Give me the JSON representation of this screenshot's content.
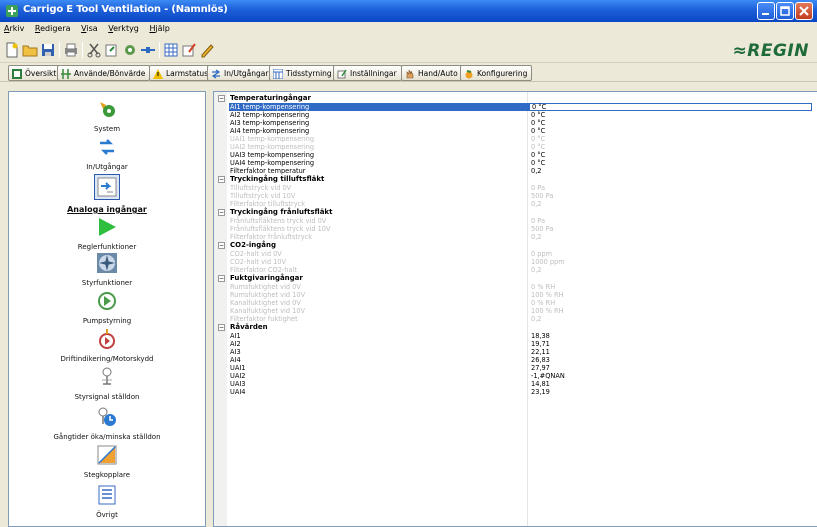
{
  "window": {
    "title": "Carrigo E Tool Ventilation - (Namnlös)"
  },
  "menu": [
    "Arkiv",
    "Redigera",
    "Visa",
    "Verktyg",
    "Hjälp"
  ],
  "brand": {
    "logo_text": "≈REGIN",
    "color": "#1f6b3a"
  },
  "toolbar2": [
    {
      "label": "Översikt",
      "icon": "overview-icon"
    },
    {
      "label": "Använde/Bönvärde",
      "icon": "setpoint-icon"
    },
    {
      "label": "Larmstatus",
      "icon": "alarm-icon"
    },
    {
      "label": "In/Utgångar",
      "icon": "io-icon"
    },
    {
      "label": "Tidsstyrning",
      "icon": "schedule-icon"
    },
    {
      "label": "Inställningar",
      "icon": "settings-icon"
    },
    {
      "label": "Hand/Auto",
      "icon": "hand-auto-icon"
    },
    {
      "label": "Konfigurering",
      "icon": "configure-icon"
    }
  ],
  "nav": [
    {
      "label": "System",
      "icon": "system-icon",
      "active": false
    },
    {
      "label": "In/Utgångar",
      "icon": "inout-icon",
      "active": false
    },
    {
      "label": "Analoga ingångar",
      "icon": "analog-inputs-icon",
      "active": true
    },
    {
      "label": "Reglerfunktioner",
      "icon": "control-functions-icon",
      "active": false
    },
    {
      "label": "Styrfunktioner",
      "icon": "fan-icon",
      "active": false
    },
    {
      "label": "Pumpstyrning",
      "icon": "pump-icon",
      "active": false
    },
    {
      "label": "Driftindikering/Motorskydd",
      "icon": "motor-icon",
      "active": false
    },
    {
      "label": "Styrsignal ställdon",
      "icon": "actuator-signal-icon",
      "active": false
    },
    {
      "label": "Gångtider öka/minska ställdon",
      "icon": "actuator-time-icon",
      "active": false
    },
    {
      "label": "Stegkopplare",
      "icon": "step-switch-icon",
      "active": false
    },
    {
      "label": "Övrigt",
      "icon": "misc-icon",
      "active": false
    }
  ],
  "categories": [
    {
      "name": "Temperaturingångar",
      "rows": [
        {
          "name": "AI1 temp-kompensering",
          "value": "0 °C",
          "disabled": false,
          "selected": true
        },
        {
          "name": "AI2 temp-kompensering",
          "value": "0 °C",
          "disabled": false
        },
        {
          "name": "AI3 temp-kompensering",
          "value": "0 °C",
          "disabled": false
        },
        {
          "name": "AI4 temp-kompensering",
          "value": "0 °C",
          "disabled": false
        },
        {
          "name": "UAI1 temp-kompensering",
          "value": "0 °C",
          "disabled": true
        },
        {
          "name": "UAI2 temp-kompensering",
          "value": "0 °C",
          "disabled": true
        },
        {
          "name": "UAI3 temp-kompensering",
          "value": "0 °C",
          "disabled": false
        },
        {
          "name": "UAI4 temp-kompensering",
          "value": "0 °C",
          "disabled": false
        },
        {
          "name": "Filterfaktor temperatur",
          "value": "0,2",
          "disabled": false
        }
      ]
    },
    {
      "name": "Tryckingång tilluftsfläkt",
      "rows": [
        {
          "name": "Tilluftstryck vid 0V",
          "value": "0 Pa",
          "disabled": true
        },
        {
          "name": "Tilluftstryck vid 10V",
          "value": "500 Pa",
          "disabled": true
        },
        {
          "name": "Filterfaktor tilluftstryck",
          "value": "0,2",
          "disabled": true
        }
      ]
    },
    {
      "name": "Tryckingång frånluftsfläkt",
      "rows": [
        {
          "name": "Frånluftsfläktens tryck vid 0V",
          "value": "0 Pa",
          "disabled": true
        },
        {
          "name": "Frånluftsfläktens tryck vid 10V",
          "value": "500 Pa",
          "disabled": true
        },
        {
          "name": "Filterfaktor frånluftstryck",
          "value": "0,2",
          "disabled": true
        }
      ]
    },
    {
      "name": "CO2-ingång",
      "rows": [
        {
          "name": "CO2-halt vid 0V",
          "value": "0 ppm",
          "disabled": true
        },
        {
          "name": "CO2-halt vid 10V",
          "value": "1000 ppm",
          "disabled": true
        },
        {
          "name": "Filterfaktor CO2-halt",
          "value": "0,2",
          "disabled": true
        }
      ]
    },
    {
      "name": "Fuktgivaringångar",
      "rows": [
        {
          "name": "Rumsfuktighet vid 0V",
          "value": "0 % RH",
          "disabled": true
        },
        {
          "name": "Rumsfuktighet vid 10V",
          "value": "100 % RH",
          "disabled": true
        },
        {
          "name": "Kanalfuktighet vid 0V",
          "value": "0 % RH",
          "disabled": true
        },
        {
          "name": "Kanalfuktighet vid 10V",
          "value": "100 % RH",
          "disabled": true
        },
        {
          "name": "Filterfaktor fuktighet",
          "value": "0,2",
          "disabled": true
        }
      ]
    },
    {
      "name": "Råvärden",
      "rows": [
        {
          "name": "AI1",
          "value": "18,38",
          "disabled": false
        },
        {
          "name": "AI2",
          "value": "19,71",
          "disabled": false
        },
        {
          "name": "AI3",
          "value": "22,11",
          "disabled": false
        },
        {
          "name": "AI4",
          "value": "26,83",
          "disabled": false
        },
        {
          "name": "UAI1",
          "value": "27,97",
          "disabled": false
        },
        {
          "name": "UAI2",
          "value": "-1,#QNAN",
          "disabled": false
        },
        {
          "name": "UAI3",
          "value": "14,81",
          "disabled": false
        },
        {
          "name": "UAI4",
          "value": "23,19",
          "disabled": false
        }
      ]
    }
  ]
}
